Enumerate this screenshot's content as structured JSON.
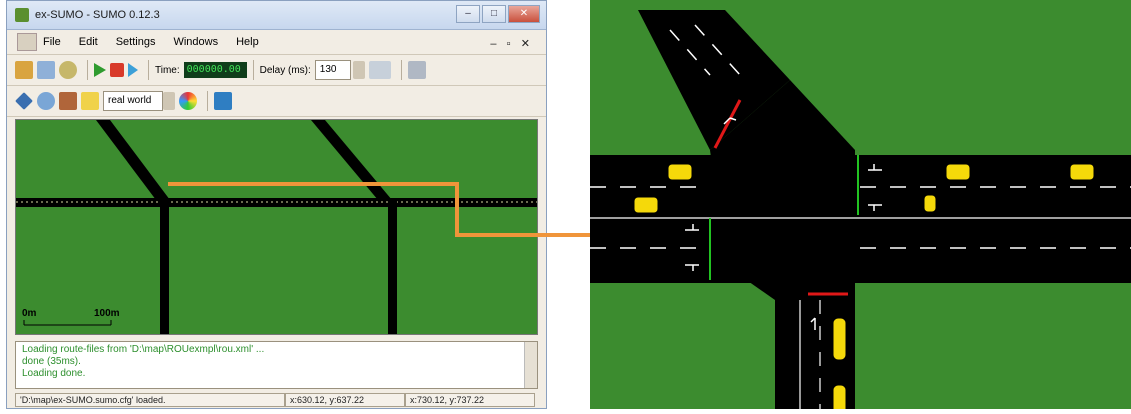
{
  "window": {
    "title": "ex-SUMO - SUMO 0.12.3",
    "controls": [
      "minimize-icon",
      "maximize-icon",
      "close-icon"
    ]
  },
  "menu": {
    "items": [
      "File",
      "Edit",
      "Settings",
      "Windows",
      "Help"
    ]
  },
  "toolbar": {
    "time_label": "Time:",
    "time_value": "000000.00",
    "delay_label": "Delay (ms):",
    "delay_value": "130",
    "viewport_select": "real world"
  },
  "view": {
    "scale_start": "0m",
    "scale_end": "100m"
  },
  "log": {
    "lines": [
      "Loading route-files from 'D:\\map\\ROUexmpl\\rou.xml' ...",
      " done (35ms).",
      "Loading done."
    ]
  },
  "status": {
    "message": "'D:\\map\\ex-SUMO.sumo.cfg' loaded.",
    "coord1": "x:630.12, y:637.22",
    "coord2": "x:730.12, y:737.22"
  },
  "colors": {
    "grass": "#3c8c2f",
    "road": "#000000",
    "arrow": "#f0953a",
    "vehicle": "#f5d90a",
    "stopline_red": "#e01818",
    "stopline_green": "#22c322"
  }
}
